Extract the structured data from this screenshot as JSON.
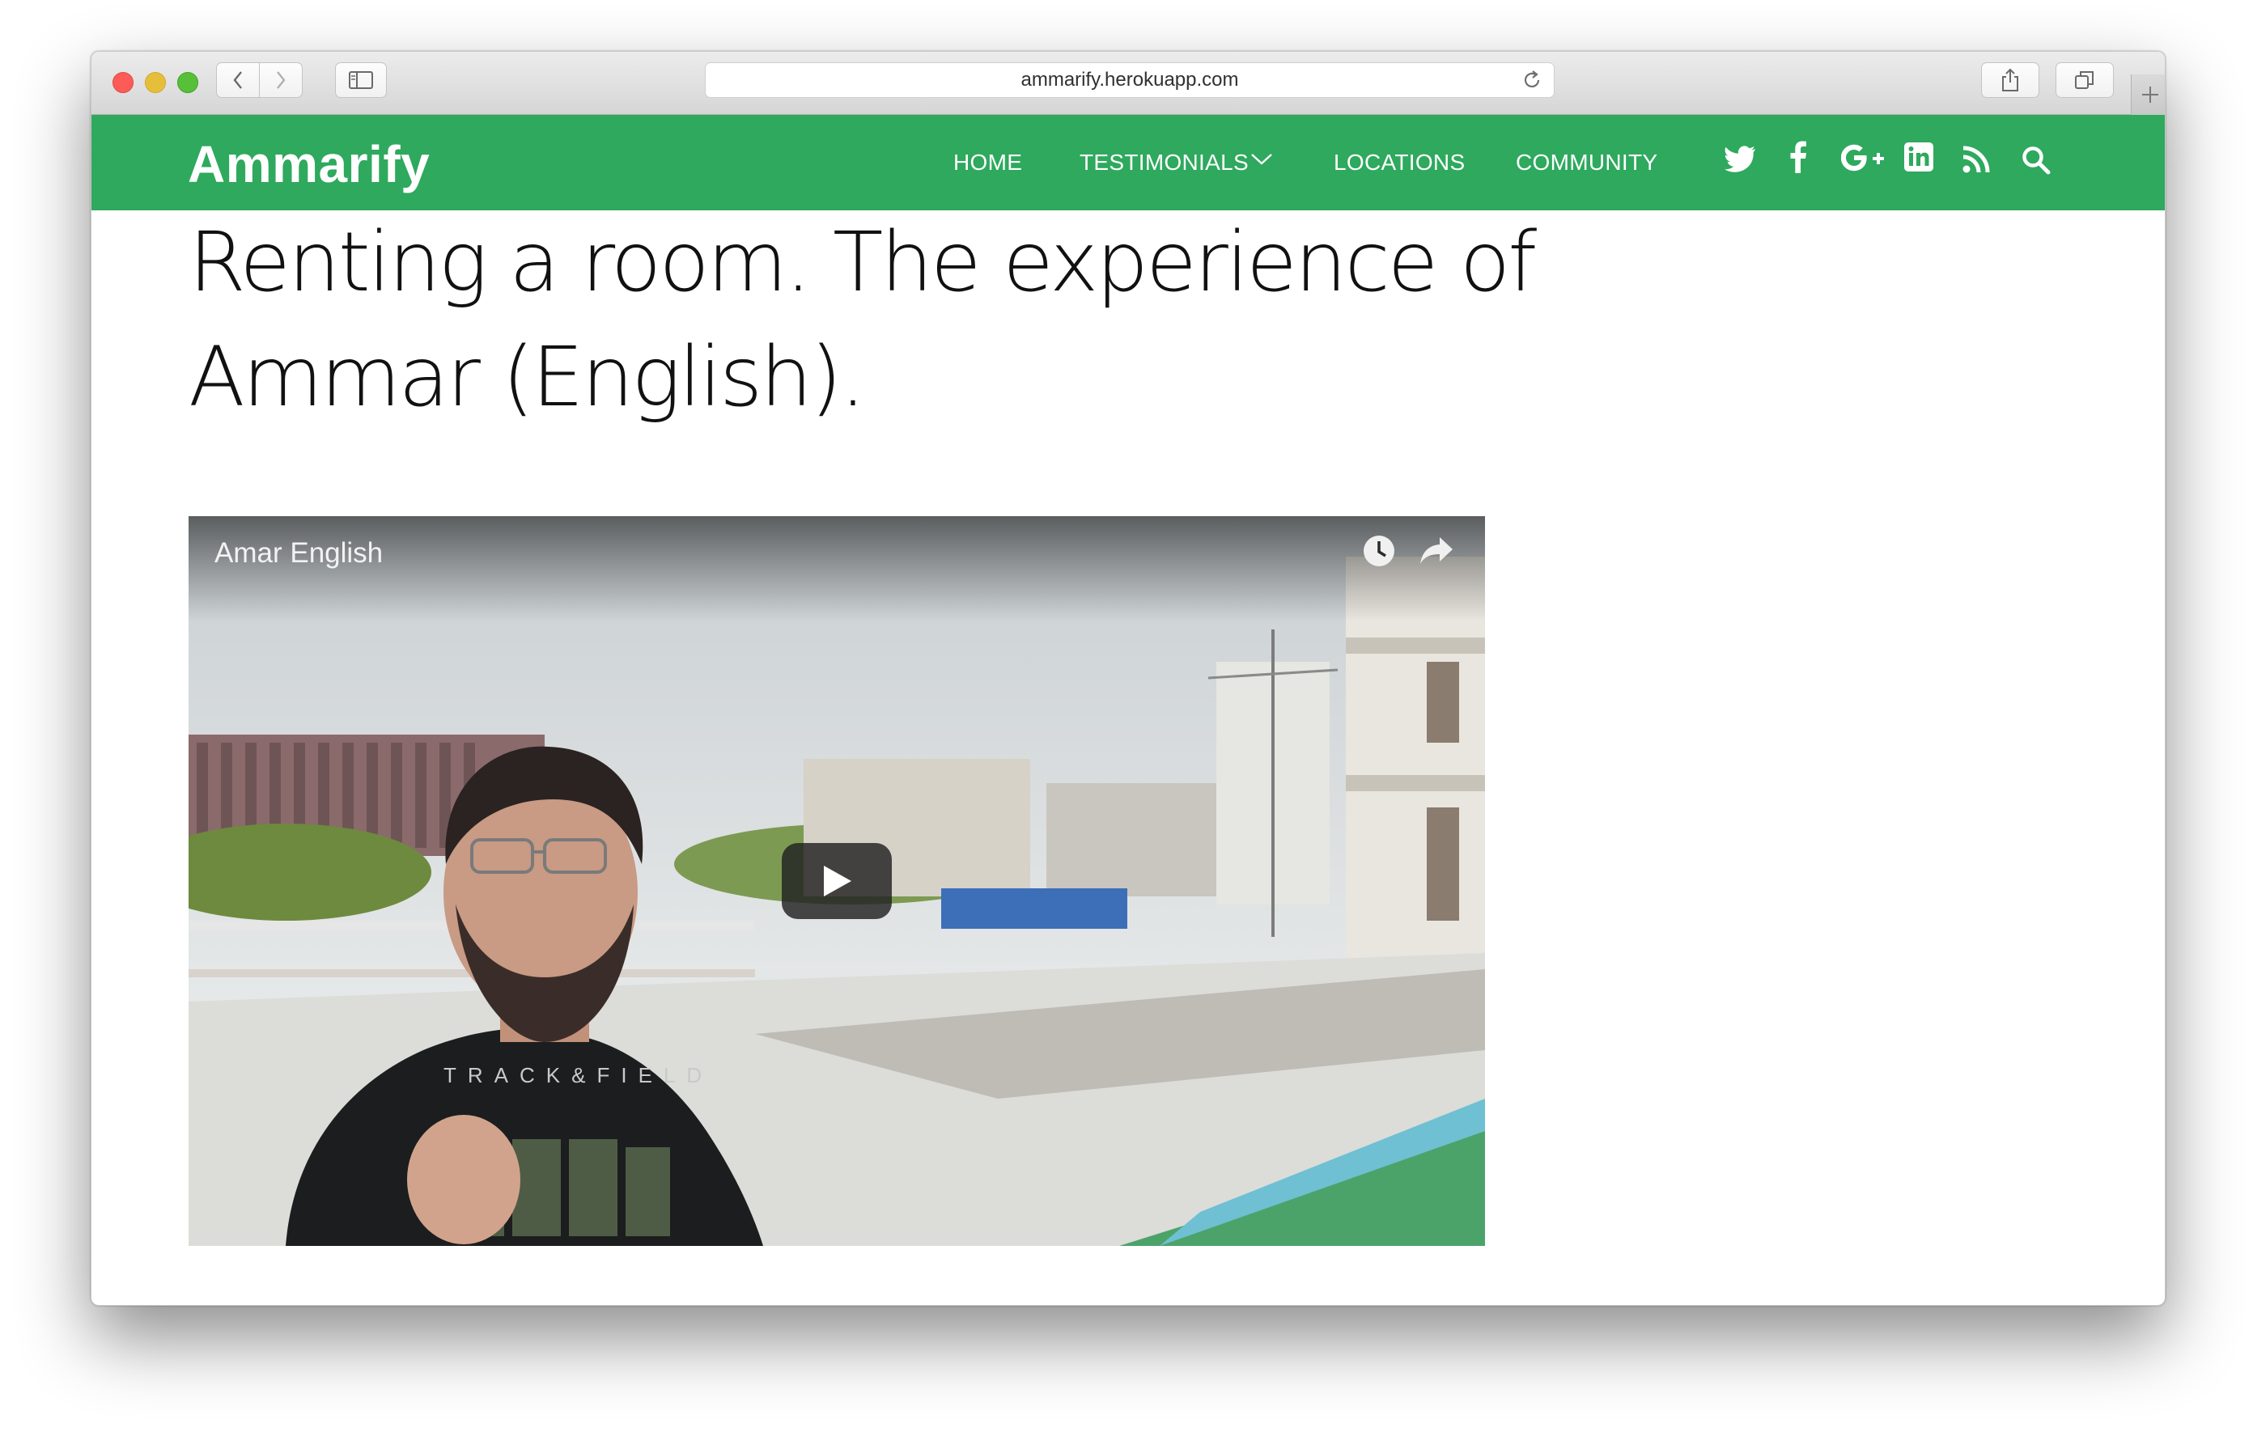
{
  "browser": {
    "url": "ammarify.herokuapp.com"
  },
  "site": {
    "logo": "Ammarify",
    "nav": [
      {
        "label": "HOME"
      },
      {
        "label": "TESTIMONIALS"
      },
      {
        "label": "LOCATIONS"
      },
      {
        "label": "COMMUNITY"
      }
    ],
    "social_icons": [
      "twitter-icon",
      "facebook-icon",
      "google-plus-icon",
      "linkedin-icon",
      "rss-icon",
      "search-icon"
    ],
    "brand_color": "#2ea95d"
  },
  "article": {
    "title_line1": "Renting a room. The experience of",
    "title_line2": "Ammar (English)."
  },
  "video": {
    "title": "Amar English",
    "controls": [
      "clock-icon",
      "share-icon",
      "play-icon"
    ]
  }
}
